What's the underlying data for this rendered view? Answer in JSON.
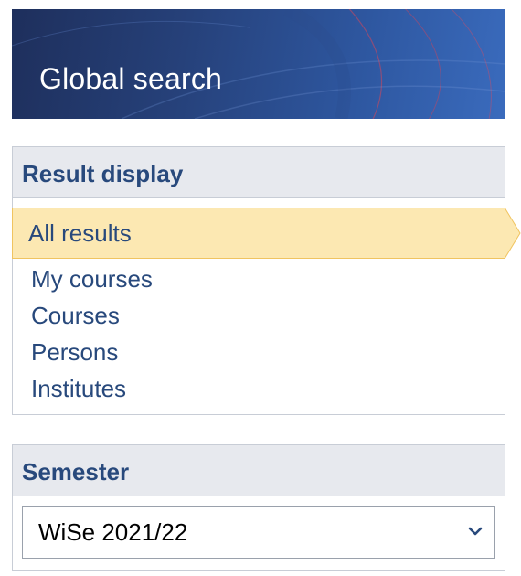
{
  "banner": {
    "title": "Global search"
  },
  "result_display": {
    "heading": "Result display",
    "items": [
      {
        "label": "All results",
        "active": true
      },
      {
        "label": "My courses",
        "active": false
      },
      {
        "label": "Courses",
        "active": false
      },
      {
        "label": "Persons",
        "active": false
      },
      {
        "label": "Institutes",
        "active": false
      }
    ]
  },
  "semester": {
    "heading": "Semester",
    "selected": "WiSe 2021/22"
  },
  "colors": {
    "heading_text": "#28497c",
    "active_bg": "#fce8b2",
    "active_border": "#f0c460",
    "header_bg": "#e7e9ee",
    "banner_dark": "#1e2f5c",
    "banner_light": "#3a6bbd"
  },
  "icons": {
    "select_chevron": "chevron-down-icon"
  }
}
